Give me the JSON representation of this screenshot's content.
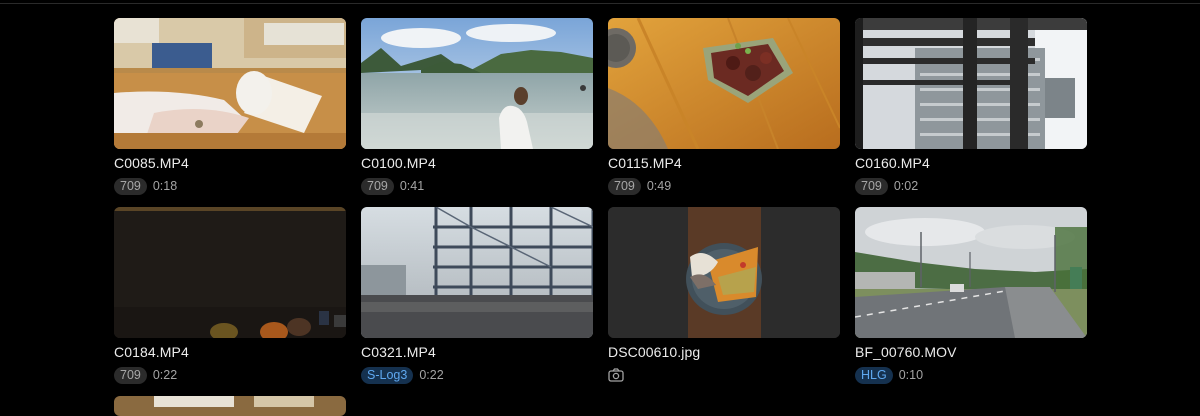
{
  "items": [
    {
      "name": "C0085.MP4",
      "badge": "709",
      "duration": "0:18",
      "type": "video"
    },
    {
      "name": "C0100.MP4",
      "badge": "709",
      "duration": "0:41",
      "type": "video"
    },
    {
      "name": "C0115.MP4",
      "badge": "709",
      "duration": "0:49",
      "type": "video"
    },
    {
      "name": "C0160.MP4",
      "badge": "709",
      "duration": "0:02",
      "type": "video"
    },
    {
      "name": "C0184.MP4",
      "badge": "709",
      "duration": "0:22",
      "type": "video"
    },
    {
      "name": "C0321.MP4",
      "badge": "S-Log3",
      "duration": "0:22",
      "type": "video",
      "badge_color": "#5fa8f0"
    },
    {
      "name": "DSC00610.jpg",
      "type": "photo",
      "icon": "camera-icon"
    },
    {
      "name": "BF_00760.MOV",
      "badge": "HLG",
      "duration": "0:10",
      "type": "video",
      "badge_color": "#5fa8f0"
    }
  ],
  "colors": {
    "background": "#000000",
    "badge_default_bg": "#2b2b2b",
    "badge_blue_bg": "#15314f",
    "badge_blue_text": "#5fa8f0"
  }
}
